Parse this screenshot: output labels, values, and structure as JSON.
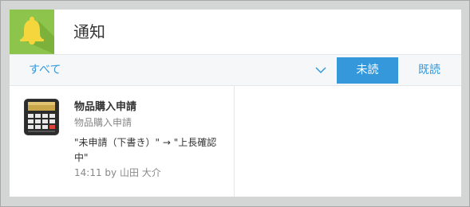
{
  "header": {
    "title": "通知",
    "icon": "bell-icon",
    "icon_bg": "#8dc44b"
  },
  "toolbar": {
    "filter_value": "すべて",
    "unread_label": "未読",
    "read_label": "既読",
    "accent": "#3498db"
  },
  "notifications": [
    {
      "title": "物品購入申請",
      "app": "物品購入申請",
      "icon": "calculator-icon",
      "body": "\"未申請（下書き）\" → \"上長確認中\"",
      "time": "14:11",
      "by_label": "by",
      "user": "山田 大介"
    }
  ]
}
